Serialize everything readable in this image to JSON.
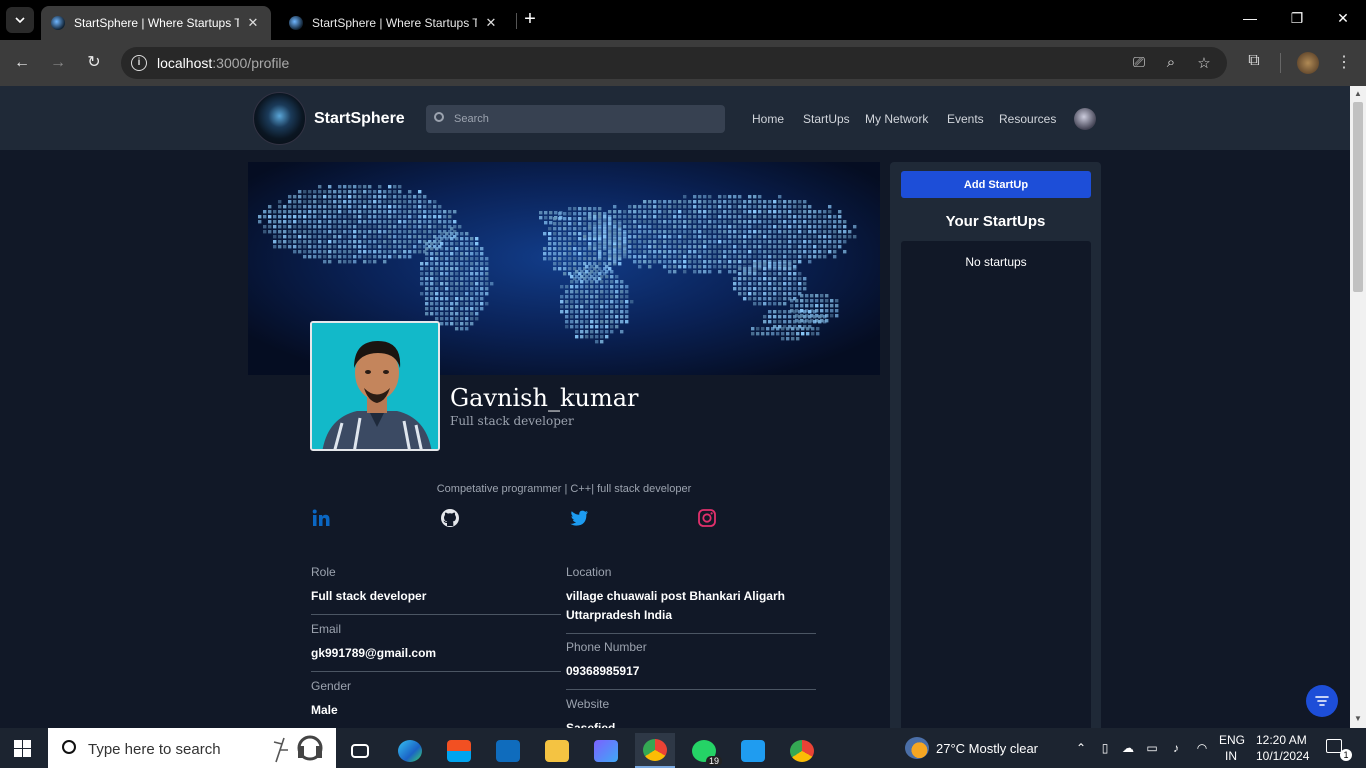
{
  "browser": {
    "tabs": [
      {
        "title": "StartSphere | Where Startups Take Flight",
        "active": true
      },
      {
        "title": "StartSphere | Where Startups Take Flight",
        "active": false
      }
    ],
    "url_host": "localhost",
    "url_path": ":3000/profile"
  },
  "site": {
    "brand": "StartSphere",
    "search_placeholder": "Search",
    "nav": [
      "Home",
      "StartUps",
      "My Network",
      "Events",
      "Resources"
    ]
  },
  "profile": {
    "name": "Gavnish_kumar",
    "title": "Full stack developer",
    "bio": "Competative programmer | C++| full stack developer",
    "social_icons": [
      "linkedin-icon",
      "github-icon",
      "twitter-icon",
      "instagram-icon"
    ],
    "fields": {
      "role": {
        "label": "Role",
        "value": "Full stack developer"
      },
      "email": {
        "label": "Email",
        "value": "gk991789@gmail.com"
      },
      "gender": {
        "label": "Gender",
        "value": "Male"
      },
      "location": {
        "label": "Location",
        "value": "village chuawali post Bhankari Aligarh Uttarpradesh India"
      },
      "phone": {
        "label": "Phone Number",
        "value": "09368985917"
      },
      "website": {
        "label": "Website",
        "value": "Sasefied"
      }
    }
  },
  "sidebar": {
    "add_button": "Add StartUp",
    "heading": "Your StartUps",
    "empty_text": "No startups"
  },
  "taskbar": {
    "search_placeholder": "Type here to search",
    "weather": "27°C  Mostly clear",
    "lang_top": "ENG",
    "lang_bottom": "IN",
    "time": "12:20 AM",
    "date": "10/1/2024",
    "whatsapp_badge": "19",
    "notification_count": "1"
  },
  "colors": {
    "page_bg": "#111827",
    "header_bg": "#1f2937",
    "accent": "#1d4ed8",
    "linkedin": "#0a66c2",
    "twitter": "#1d9bf0",
    "instagram": "#e1306c"
  }
}
